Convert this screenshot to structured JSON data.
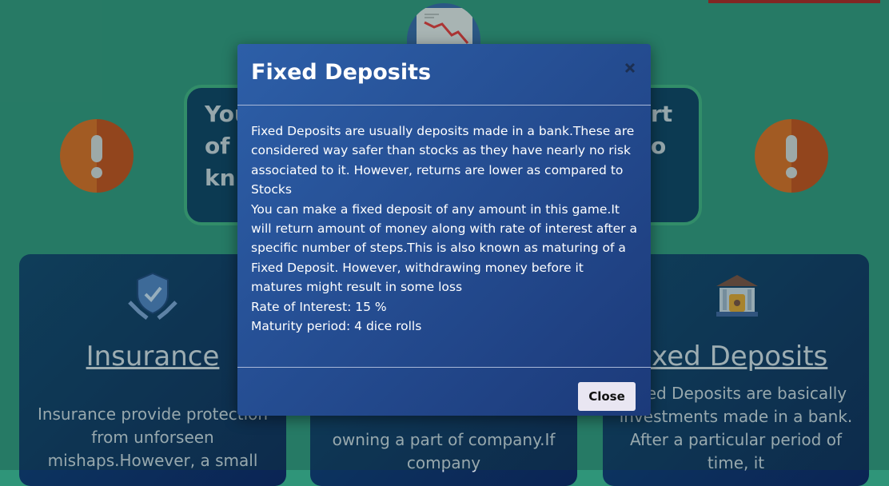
{
  "background": {
    "hero": {
      "left_lines": [
        "You",
        "of",
        "kn"
      ],
      "right_lines": [
        "rt",
        "o"
      ]
    },
    "cards": [
      {
        "title": "Insurance",
        "text": "Insurance provide protection from unforseen mishaps.However, a small"
      },
      {
        "title": "",
        "text": "owning a part of company.If company"
      },
      {
        "title": "ixed Deposits",
        "text": "Fixed Deposits are basically investments made in a bank. After a particular period of time, it"
      }
    ]
  },
  "modal": {
    "title": "Fixed Deposits",
    "close_label": "Close",
    "paragraphs": [
      "Fixed Deposits are usually deposits made in a bank.These are considered way safer than stocks as they have nearly no risk associated to it. However, returns are lower as compared to Stocks",
      "You can make a fixed deposit of any amount in this game.It will return amount of money along with rate of interest after a specific number of steps.This is also known as maturing of a Fixed Deposit. However, withdrawing money before it matures might result in some loss",
      "Rate of Interest: 15 %",
      "Maturity period: 4 dice rolls"
    ]
  },
  "colors": {
    "page_bg": "#2f9579",
    "modal_bg": "#2d5fa8",
    "warning": "#e0691b"
  }
}
